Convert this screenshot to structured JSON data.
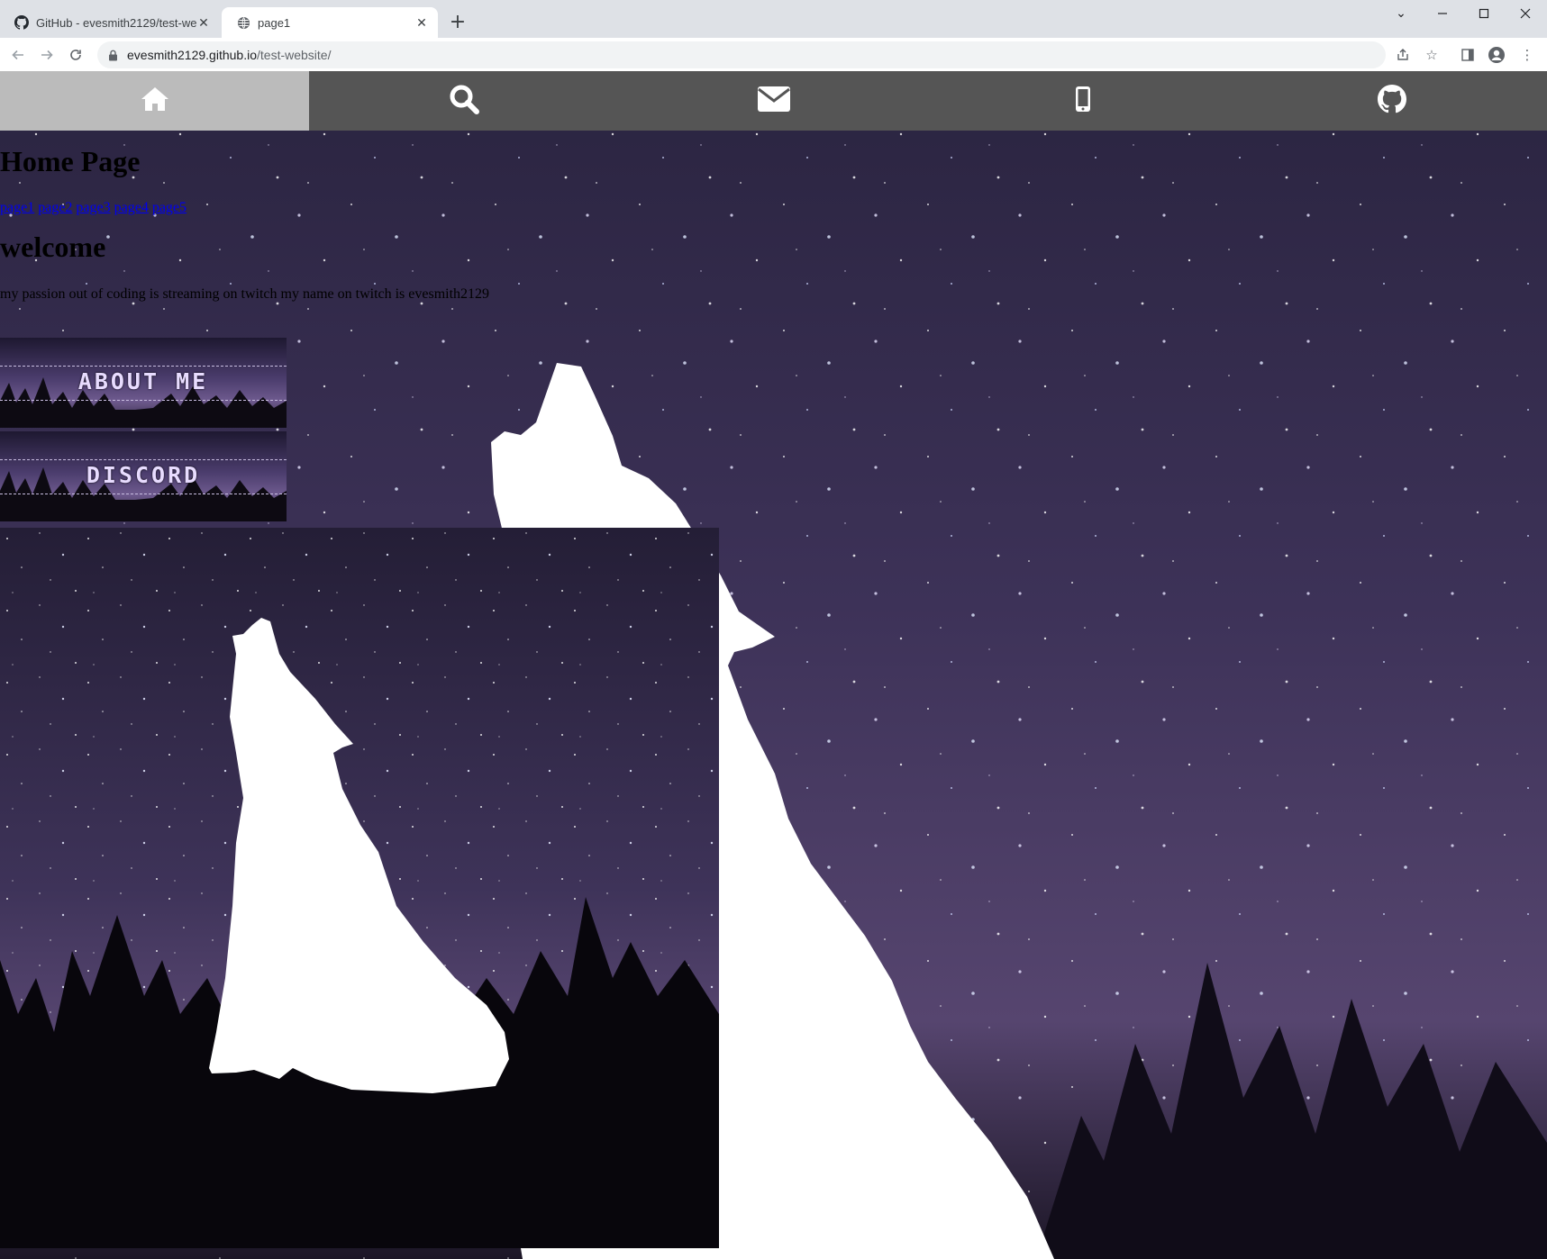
{
  "browser": {
    "tabs": [
      {
        "title": "GitHub - evesmith2129/test-web",
        "favicon": "github-icon",
        "active": false
      },
      {
        "title": "page1",
        "favicon": "globe-icon",
        "active": true
      }
    ],
    "url_host": "evesmith2129.github.io",
    "url_path": "/test-website/"
  },
  "navbar": {
    "items": [
      {
        "icon": "home-icon",
        "active": true
      },
      {
        "icon": "search-icon",
        "active": false
      },
      {
        "icon": "envelope-icon",
        "active": false
      },
      {
        "icon": "mobile-icon",
        "active": false
      },
      {
        "icon": "github-icon",
        "active": false
      }
    ]
  },
  "page": {
    "title": "Home Page",
    "links": [
      "page1",
      "page2",
      "page3",
      "page4",
      "page5"
    ],
    "welcome_heading": "welcome",
    "intro_text": "my passion out of coding is streaming on twitch my name on twitch is evesmith2129",
    "banners": {
      "about_me": "ABOUT ME",
      "discord": "DISCORD"
    }
  },
  "colors": {
    "navbar_bg": "#555555",
    "navbar_active_bg": "#bbbbbb",
    "sky": "#3a3056",
    "link": "#0000ee"
  }
}
